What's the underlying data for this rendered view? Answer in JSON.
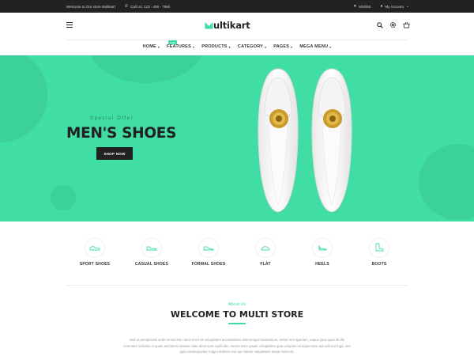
{
  "topbar": {
    "welcome": "Welcome to Our store Multikart",
    "phone": "Call Us: 123 - 456 - 7890",
    "wishlist": "Wishlist",
    "account": "My Account"
  },
  "header": {
    "logo_rest": "ultikart"
  },
  "nav": {
    "items": [
      {
        "label": "HOME"
      },
      {
        "label": "FEATURES",
        "badge": "new"
      },
      {
        "label": "PRODUCTS"
      },
      {
        "label": "CATEGORY"
      },
      {
        "label": "PAGES"
      },
      {
        "label": "MEGA MENU"
      }
    ]
  },
  "hero": {
    "tag": "Special Offer",
    "title": "MEN'S SHOES",
    "cta": "SHOP NOW"
  },
  "categories": [
    {
      "label": "SPORT SHOES",
      "icon": "sport-shoe-icon"
    },
    {
      "label": "CASUAL SHOES",
      "icon": "casual-shoe-icon"
    },
    {
      "label": "FORMAL SHOES",
      "icon": "formal-shoe-icon"
    },
    {
      "label": "FLAT",
      "icon": "flat-shoe-icon"
    },
    {
      "label": "HEELS",
      "icon": "heel-icon"
    },
    {
      "label": "BOOTS",
      "icon": "boot-icon"
    }
  ],
  "welcome": {
    "about": "About Us",
    "title": "WELCOME TO MULTI STORE",
    "text": "Sed ut perspiciatis unde omnis iste natus error sit voluptatem accusantium doloremque laudantium, totam rem aperiam, eaque ipsa quae ab illo inventore veritatis et quasi architecto beatae vitae dicta sunt explicabo. Nemo enim ipsam voluptatem quia voluptas sit aspernatur aut odit aut fugit, sed quia consequuntur magni dolores eos qui ratione voluptatem sequi nesciunt."
  },
  "colors": {
    "accent": "#40dda4",
    "dark": "#222222"
  }
}
